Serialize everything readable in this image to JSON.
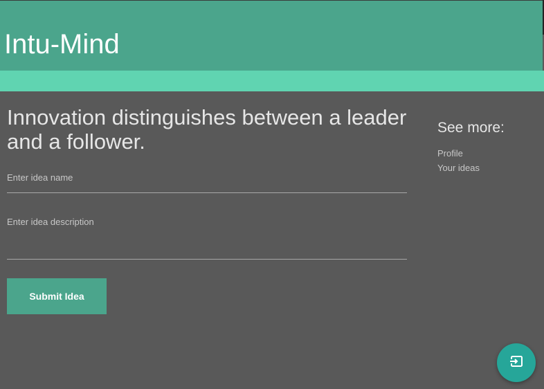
{
  "header": {
    "title": "Intu-Mind"
  },
  "main": {
    "headline": "Innovation distinguishes between a leader and a follower.",
    "idea_name_placeholder": "Enter idea name",
    "idea_description_placeholder": "Enter idea description",
    "submit_label": "Submit Idea"
  },
  "sidebar": {
    "title": "See more:",
    "links": [
      {
        "label": "Profile"
      },
      {
        "label": "Your ideas"
      }
    ]
  },
  "fab": {
    "icon": "exit-to-app-icon"
  },
  "colors": {
    "header": "#4ba58c",
    "subbar": "#60d4b1",
    "background": "#595959",
    "button": "#4ba58c",
    "fab": "#26a699"
  }
}
